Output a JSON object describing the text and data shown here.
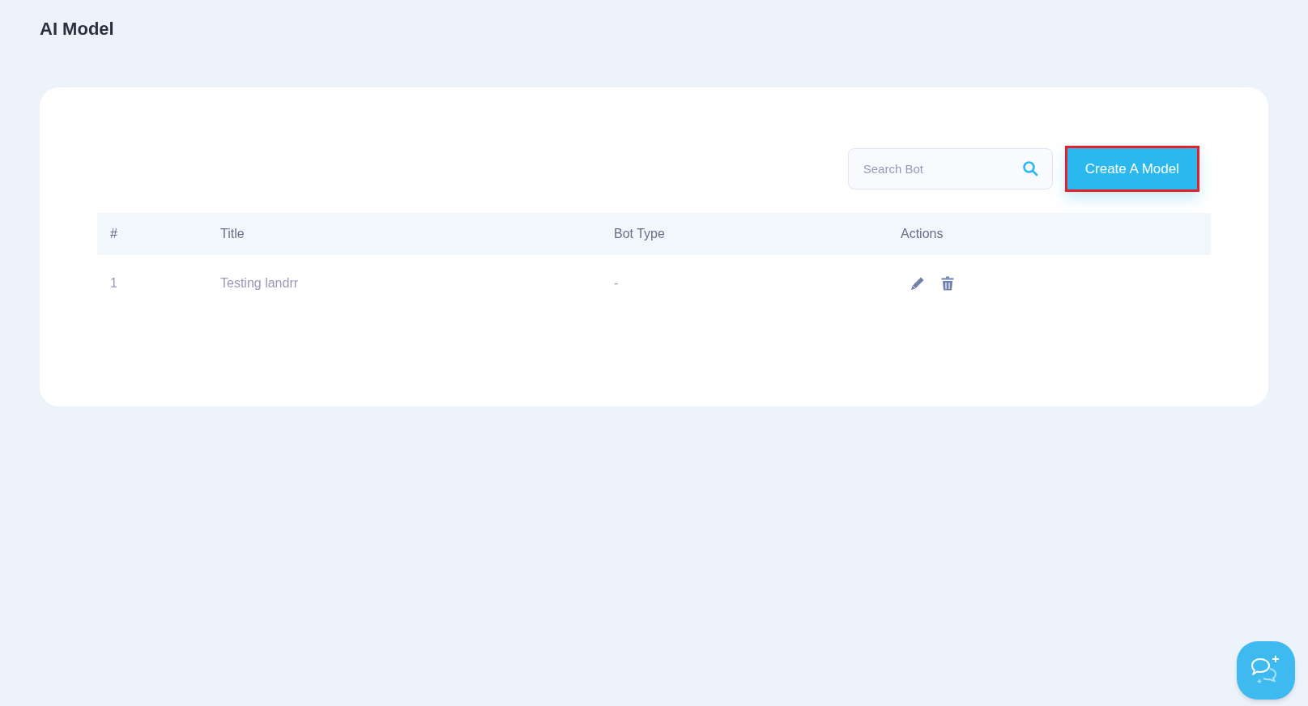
{
  "page_title": "AI Model",
  "search": {
    "placeholder": "Search Bot"
  },
  "create_button": "Create A Model",
  "table": {
    "columns": [
      "#",
      "Title",
      "Bot Type",
      "Actions"
    ],
    "rows": [
      {
        "number": "1",
        "title": "Testing landrr",
        "bot_type": "-"
      }
    ]
  }
}
